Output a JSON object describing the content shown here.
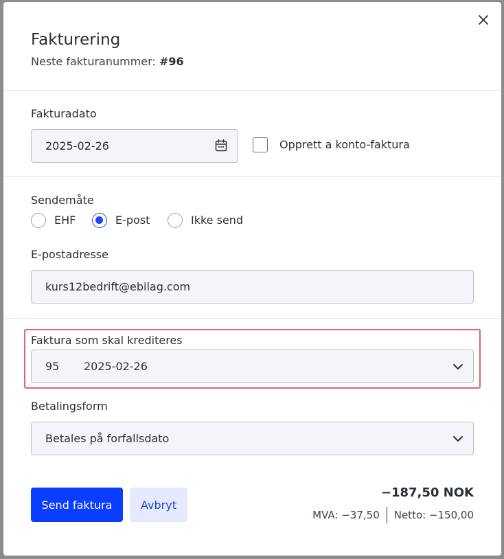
{
  "modal": {
    "title": "Fakturering",
    "subtitle_label": "Neste fakturanummer:",
    "invoice_number": "#96",
    "close_icon": "close-icon"
  },
  "invoice_date": {
    "label": "Fakturadato",
    "value": "2025-02-26",
    "icon": "calendar-icon"
  },
  "on_account": {
    "label": "Opprett a konto-faktura",
    "checked": false
  },
  "send_method": {
    "label": "Sendemåte",
    "options": [
      {
        "label": "EHF",
        "checked": false
      },
      {
        "label": "E-post",
        "checked": true
      },
      {
        "label": "Ikke send",
        "checked": false
      }
    ]
  },
  "email": {
    "label": "E-postadresse",
    "value": "kurs12bedrift@ebilag.com"
  },
  "credit_invoice": {
    "label": "Faktura som skal krediteres",
    "number": "95",
    "date": "2025-02-26",
    "icon": "chevron-down-icon"
  },
  "payment": {
    "label": "Betalingsform",
    "value": "Betales på forfallsdato",
    "icon": "chevron-down-icon"
  },
  "actions": {
    "send_label": "Send faktura",
    "cancel_label": "Avbryt"
  },
  "totals": {
    "total": "−187,50 NOK",
    "vat": "MVA: −37,50",
    "net": "Netto: −150,00"
  },
  "colors": {
    "primary": "#0a3dff",
    "highlight": "#e0646c",
    "field_bg": "#f4f5f8"
  }
}
